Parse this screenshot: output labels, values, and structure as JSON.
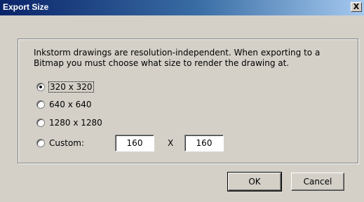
{
  "window": {
    "title": "Export Size",
    "close_label": "X"
  },
  "dialog": {
    "description": "Inkstorm drawings are resolution-independent. When exporting to a Bitmap you must choose what size to render the drawing at.",
    "options": [
      {
        "label": "320 x 320",
        "selected": true
      },
      {
        "label": "640 x 640",
        "selected": false
      },
      {
        "label": "1280 x 1280",
        "selected": false
      },
      {
        "label": "Custom:",
        "selected": false
      }
    ],
    "custom": {
      "width": "160",
      "separator": "X",
      "height": "160"
    }
  },
  "buttons": {
    "ok": "OK",
    "cancel": "Cancel"
  }
}
